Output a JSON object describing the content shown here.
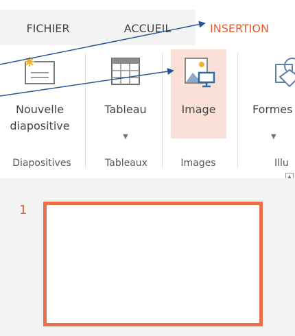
{
  "tabs": {
    "file": "FICHIER",
    "home": "ACCUEIL",
    "insert": "INSERTION"
  },
  "ribbon": {
    "new_slide": {
      "label_line1": "Nouvelle",
      "label_line2": "diapositive",
      "icon": "new-slide-icon"
    },
    "table": {
      "label": "Tableau",
      "icon": "table-icon"
    },
    "image": {
      "label": "Image",
      "icon": "picture-icon"
    },
    "shapes": {
      "label": "Formes",
      "icon": "shapes-icon"
    },
    "groups": {
      "slides": "Diapositives",
      "tables": "Tableaux",
      "images": "Images",
      "illustrations": "Illu"
    }
  },
  "slide_pane": {
    "slide_number": "1"
  },
  "colors": {
    "accent": "#e35d2f",
    "thumb_border": "#e8704b",
    "selected_bg": "#fbe0d8",
    "arrow": "#2a5594"
  }
}
